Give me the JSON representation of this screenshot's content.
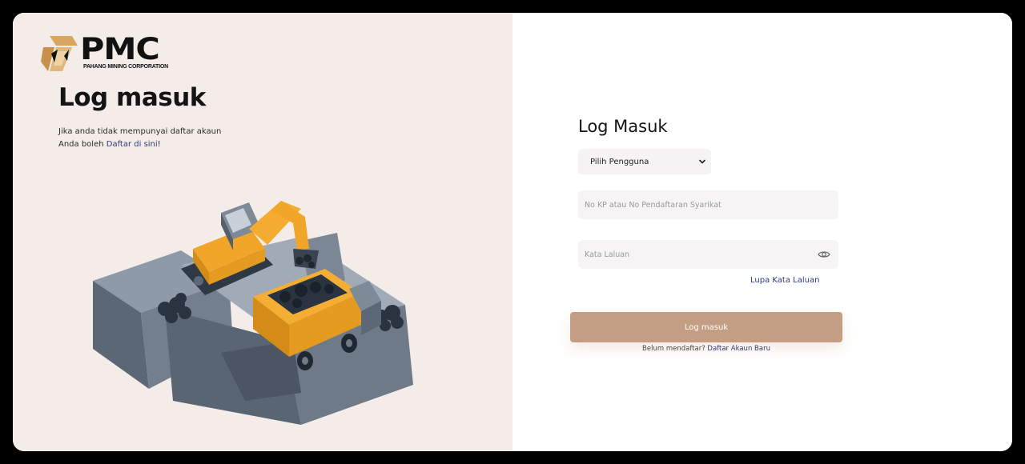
{
  "brand": {
    "logo_text": "PMC",
    "logo_subtitle": "PAHANG MINING CORPORATION",
    "accent": "#c49e82",
    "link_color": "#2d3a7c",
    "left_panel_bg": "#f4ece8"
  },
  "left_panel": {
    "heading": "Log masuk",
    "line1": "Jika anda tidak mempunyai daftar akaun",
    "line2_prefix": "Anda boleh ",
    "line2_link": "Daftar di sini",
    "line2_suffix": "!"
  },
  "form": {
    "title": "Log Masuk",
    "user_select": {
      "selected": "Pilih Pengguna",
      "icon": "chevron-down-icon"
    },
    "id_field": {
      "placeholder": "No KP atau No Pendaftaran Syarikat",
      "value": ""
    },
    "password_field": {
      "placeholder": "Kata Laluan",
      "value": "",
      "icon": "eye-icon"
    },
    "forgot_password": "Lupa Kata Laluan",
    "submit_label": "Log masuk",
    "register_prefix": "Belum mendaftar? ",
    "register_link": "Daftar Akaun Baru"
  }
}
